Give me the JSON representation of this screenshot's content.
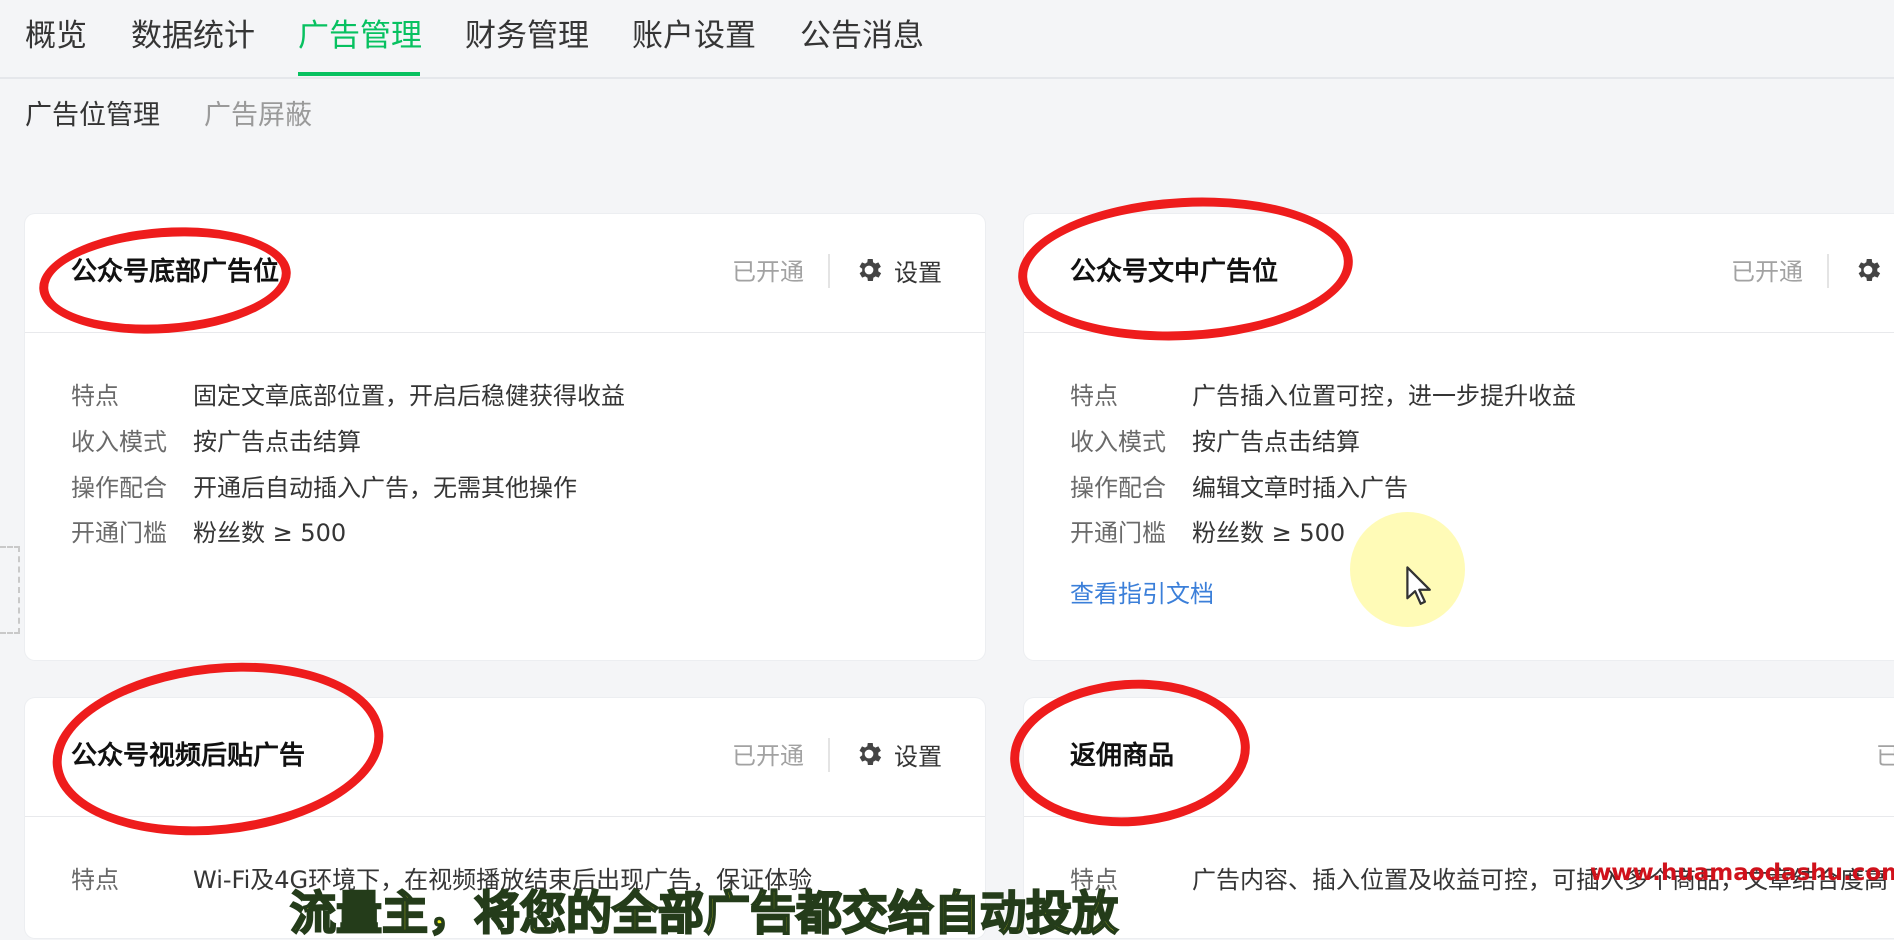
{
  "nav": {
    "tabs": [
      {
        "label": "概览"
      },
      {
        "label": "数据统计"
      },
      {
        "label": "广告管理",
        "active": true
      },
      {
        "label": "财务管理"
      },
      {
        "label": "账户设置"
      },
      {
        "label": "公告消息"
      }
    ]
  },
  "subnav": {
    "tabs": [
      {
        "label": "广告位管理",
        "active": true
      },
      {
        "label": "广告屏蔽"
      }
    ]
  },
  "cards": [
    {
      "title": "公众号底部广告位",
      "status": "已开通",
      "settings_label": "设置",
      "details": [
        {
          "key": "特点",
          "value": "固定文章底部位置，开启后稳健获得收益"
        },
        {
          "key": "收入模式",
          "value": "按广告点击结算"
        },
        {
          "key": "操作配合",
          "value": "开通后自动插入广告，无需其他操作"
        },
        {
          "key": "开通门槛",
          "value": "粉丝数 ≥ 500"
        }
      ]
    },
    {
      "title": "公众号文中广告位",
      "status": "已开通",
      "settings_label": "",
      "details": [
        {
          "key": "特点",
          "value": "广告插入位置可控，进一步提升收益"
        },
        {
          "key": "收入模式",
          "value": "按广告点击结算"
        },
        {
          "key": "操作配合",
          "value": "编辑文章时插入广告"
        },
        {
          "key": "开通门槛",
          "value": "粉丝数 ≥ 500"
        }
      ],
      "link": "查看指引文档"
    },
    {
      "title": "公众号视频后贴广告",
      "status": "已开通",
      "settings_label": "设置",
      "details": [
        {
          "key": "特点",
          "value": "Wi-Fi及4G环境下，在视频播放结束后出现广告，保证体验"
        }
      ]
    },
    {
      "title": "返佣商品",
      "status": "已",
      "details": [
        {
          "key": "特点",
          "value": "广告内容、插入位置及收益可控，可插入多个商品，文章结合度高"
        }
      ]
    }
  ],
  "overlay": {
    "watermark": "www.huamaodashu.com",
    "subtitle": "流量主，将您的全部广告都交给自动投放"
  },
  "colors": {
    "accent": "#07c160",
    "link": "#3b7fd9",
    "annotation": "#ee1c1c"
  }
}
